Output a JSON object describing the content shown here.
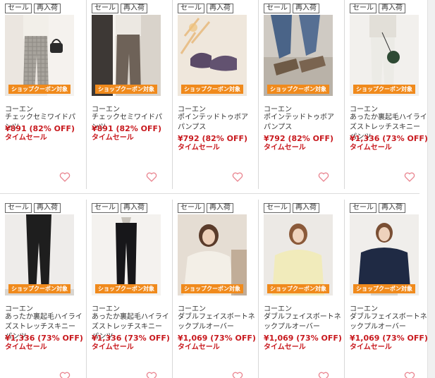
{
  "products": [
    {
      "badges": [
        "セール",
        "再入荷"
      ],
      "coupon": "ショップクーポン対象",
      "brand": "コーエン",
      "name": "チェックセミワイドパンツ",
      "price": "¥891 (82% OFF)",
      "sale": "タイムセール",
      "image": "plaid-wide-pants",
      "wishlist_icon": "heart-icon"
    },
    {
      "badges": [
        "セール",
        "再入荷"
      ],
      "coupon": "ショップクーポン対象",
      "brand": "コーエン",
      "name": "チェックセミワイドパンツ",
      "price": "¥891 (82% OFF)",
      "sale": "タイムセール",
      "image": "brown-wide-pants",
      "wishlist_icon": "heart-icon"
    },
    {
      "badges": [
        "セール",
        "再入荷"
      ],
      "coupon": "ショップクーポン対象",
      "brand": "コーエン",
      "name": "ポインテッドトゥボアパンプス",
      "price": "¥792 (82% OFF)",
      "sale": "タイムセール",
      "image": "purple-pumps",
      "wishlist_icon": "heart-icon"
    },
    {
      "badges": [
        "セール",
        "再入荷"
      ],
      "coupon": "ショップクーポン対象",
      "brand": "コーエン",
      "name": "ポインテッドトゥボアパンプス",
      "price": "¥792 (82% OFF)",
      "sale": "タイムセール",
      "image": "brown-pumps-worn",
      "wishlist_icon": "heart-icon"
    },
    {
      "badges": [
        "セール",
        "再入荷"
      ],
      "coupon": "ショップクーポン対象",
      "brand": "コーエン",
      "name": "あったか裏起毛ハイライズストレッチスキニーパンツ",
      "price": "¥1,336 (73% OFF)",
      "sale": "タイムセール",
      "image": "white-skinny-pants",
      "wishlist_icon": "heart-icon"
    },
    {
      "badges": [
        "セール",
        "再入荷"
      ],
      "coupon": "ショップクーポン対象",
      "brand": "コーエン",
      "name": "あったか裏起毛ハイライズストレッチスキニーパンツ",
      "price": "¥1,336 (73% OFF)",
      "sale": "タイムセール",
      "image": "black-skinny-worn",
      "wishlist_icon": "heart-icon"
    },
    {
      "badges": [
        "セール",
        "再入荷"
      ],
      "coupon": "ショップクーポン対象",
      "brand": "コーエン",
      "name": "あったか裏起毛ハイライズストレッチスキニーパンツ",
      "price": "¥1,336 (73% OFF)",
      "sale": "タイムセール",
      "image": "black-skinny-hanger",
      "wishlist_icon": "heart-icon"
    },
    {
      "badges": [
        "セール",
        "再入荷"
      ],
      "coupon": "ショップクーポン対象",
      "brand": "コーエン",
      "name": "ダブルフェイスボートネックプルオーバー",
      "price": "¥1,069 (73% OFF)",
      "sale": "タイムセール",
      "image": "ivory-pullover",
      "wishlist_icon": "heart-icon"
    },
    {
      "badges": [
        "セール",
        "再入荷"
      ],
      "coupon": "ショップクーポン対象",
      "brand": "コーエン",
      "name": "ダブルフェイスボートネックプルオーバー",
      "price": "¥1,069 (73% OFF)",
      "sale": "タイムセール",
      "image": "yellow-pullover",
      "wishlist_icon": "heart-icon"
    },
    {
      "badges": [
        "セール",
        "再入荷"
      ],
      "coupon": "ショップクーポン対象",
      "brand": "コーエン",
      "name": "ダブルフェイスボートネックプルオーバー",
      "price": "¥1,069 (73% OFF)",
      "sale": "タイムセール",
      "image": "navy-pullover",
      "wishlist_icon": "heart-icon"
    }
  ],
  "colors": {
    "price": "#c8191e",
    "coupon": "#f08a1c",
    "heart": "#e9848f"
  }
}
